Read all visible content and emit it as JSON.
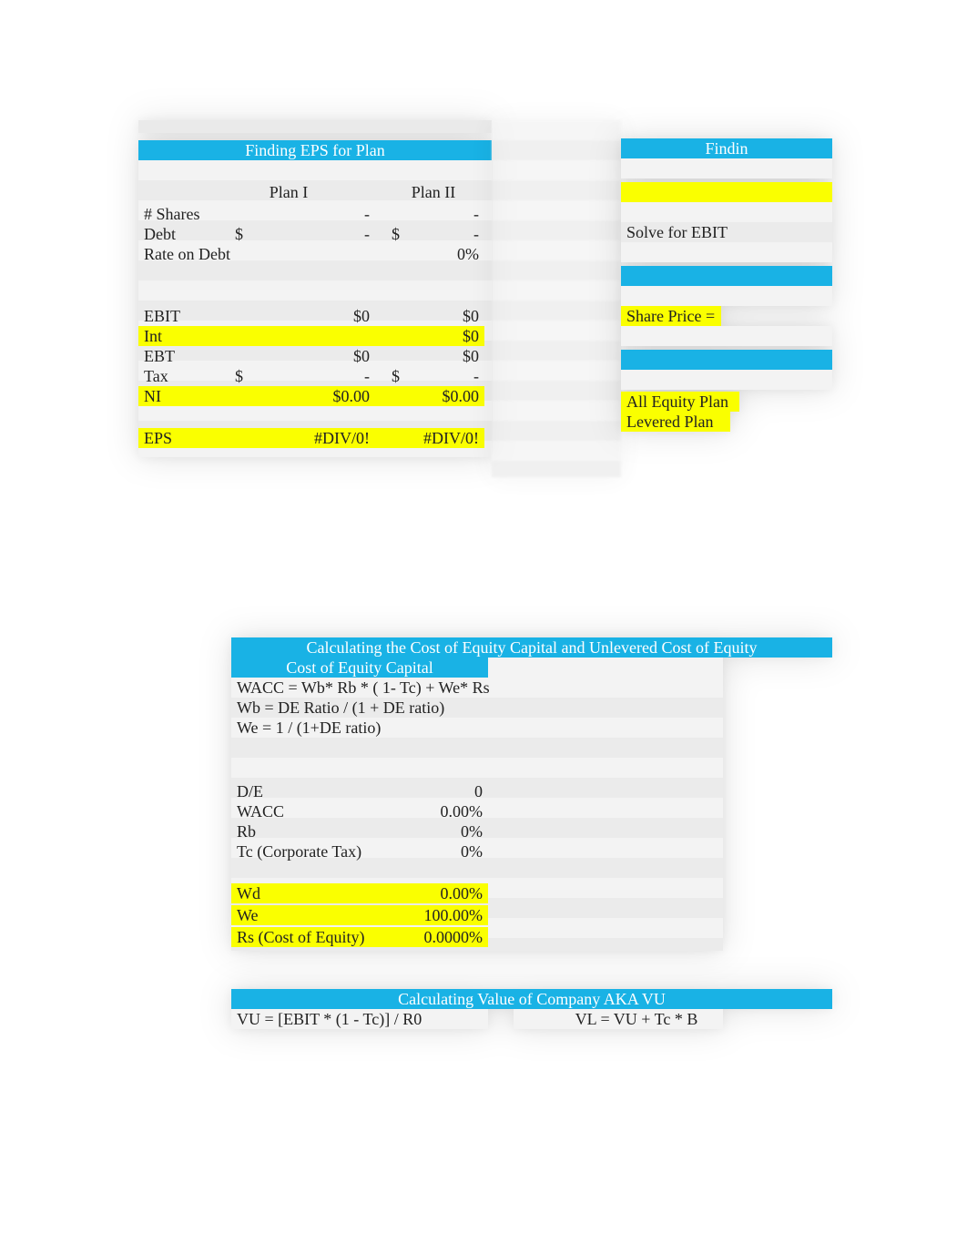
{
  "eps_block": {
    "title": "Finding EPS for Plan",
    "col_headers": {
      "plan1": "Plan I",
      "plan2": "Plan II"
    },
    "rows": {
      "shares": {
        "label": "# Shares",
        "plan1": "-",
        "plan2": "-"
      },
      "debt": {
        "label": "Debt",
        "sym": "$",
        "plan1": "-",
        "plan2": "-"
      },
      "rate": {
        "label": "Rate on Debt",
        "plan1": "",
        "plan2": "0%"
      },
      "ebit": {
        "label": "EBIT",
        "plan1": "$0",
        "plan2": "$0"
      },
      "int": {
        "label": "Int",
        "plan1": "",
        "plan2": "$0"
      },
      "ebt": {
        "label": "EBT",
        "plan1": "$0",
        "plan2": "$0"
      },
      "tax": {
        "label": "Tax",
        "sym": "$",
        "plan1": "-",
        "plan2": "-"
      },
      "ni": {
        "label": "NI",
        "plan1": "$0.00",
        "plan2": "$0.00"
      },
      "eps": {
        "label": "EPS",
        "plan1": "#DIV/0!",
        "plan2": "#DIV/0!"
      }
    }
  },
  "side_block": {
    "title": "Findin",
    "solve": "Solve for EBIT",
    "share_price": "Share Price =",
    "all_equity": "All Equity Plan",
    "levered": "Levered Plan"
  },
  "coe_block": {
    "title": "Calculating the Cost of Equity Capital and Unlevered Cost of Equity",
    "subhead": "Cost of Equity Capital",
    "formula1": "WACC = Wb* Rb * ( 1- Tc) + We* Rs",
    "formula2": "Wb = DE Ratio / (1 + DE ratio)",
    "formula3": "We = 1 / (1+DE ratio)",
    "rows": {
      "de": {
        "label": "D/E",
        "value": "0"
      },
      "wacc": {
        "label": "WACC",
        "value": "0.00%"
      },
      "rb": {
        "label": "Rb",
        "value": "0%"
      },
      "tc": {
        "label": "Tc (Corporate Tax)",
        "value": "0%"
      },
      "wd": {
        "label": "Wd",
        "value": "0.00%"
      },
      "we": {
        "label": "We",
        "value": "100.00%"
      },
      "rs": {
        "label": "Rs (Cost of Equity)",
        "value": "0.0000%"
      }
    }
  },
  "vu_block": {
    "title": "Calculating Value of Company  AKA VU",
    "left_formula": "VU = [EBIT * (1 - Tc)] / R0",
    "right_formula": "VL = VU + Tc * B"
  }
}
